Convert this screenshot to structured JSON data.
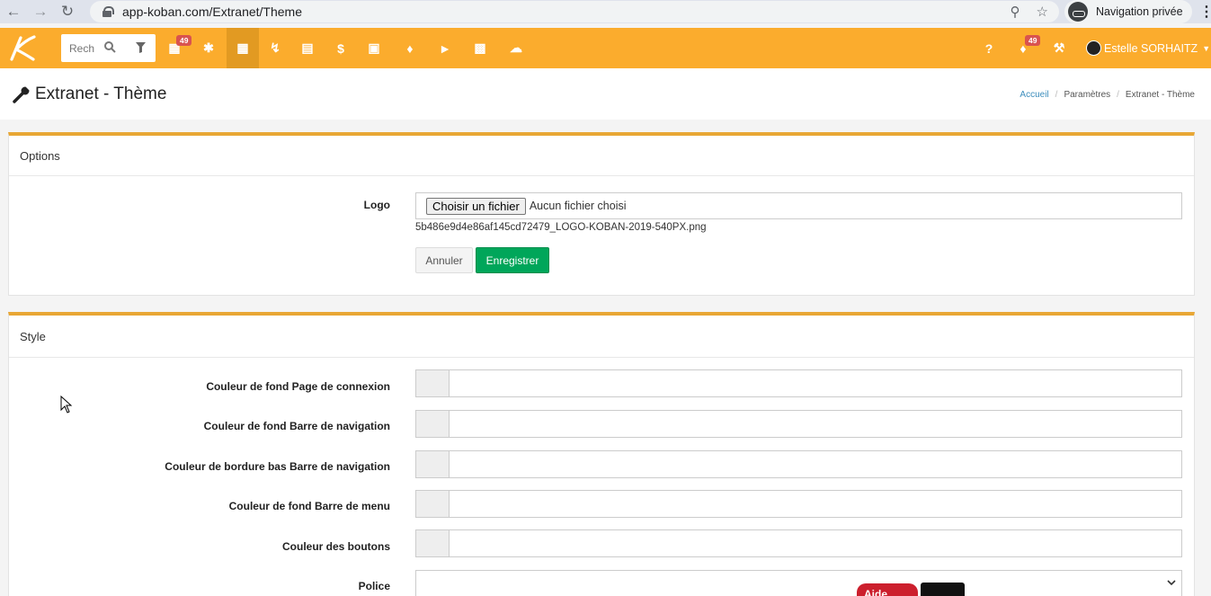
{
  "browser": {
    "url": "app-koban.com/Extranet/Theme",
    "private_label": "Navigation privée"
  },
  "header": {
    "search_placeholder": "Rechercher",
    "calendar_badge": "49",
    "notifications_badge": "49",
    "user_name": "Estelle SORHAITZ",
    "brand_color": "#fbac2d"
  },
  "page": {
    "title": "Extranet - Thème",
    "breadcrumb": [
      "Accueil",
      "Paramètres",
      "Extranet - Thème"
    ]
  },
  "options_panel": {
    "title": "Options",
    "logo_label": "Logo",
    "choose_file": "Choisir un fichier",
    "no_file": "Aucun fichier choisi",
    "current_file": "5b486e9d4e86af145cd72479_LOGO-KOBAN-2019-540PX.png",
    "cancel_label": "Annuler",
    "save_label": "Enregistrer"
  },
  "style_panel": {
    "title": "Style",
    "fields": [
      {
        "label": "Couleur de fond Page de connexion",
        "value": ""
      },
      {
        "label": "Couleur de fond Barre de navigation",
        "value": ""
      },
      {
        "label": "Couleur de bordure bas Barre de navigation",
        "value": ""
      },
      {
        "label": "Couleur de fond Barre de menu",
        "value": ""
      },
      {
        "label": "Couleur des boutons",
        "value": ""
      }
    ],
    "font_label": "Police",
    "font_value": ""
  },
  "floating": {
    "help_label": "Aide"
  }
}
